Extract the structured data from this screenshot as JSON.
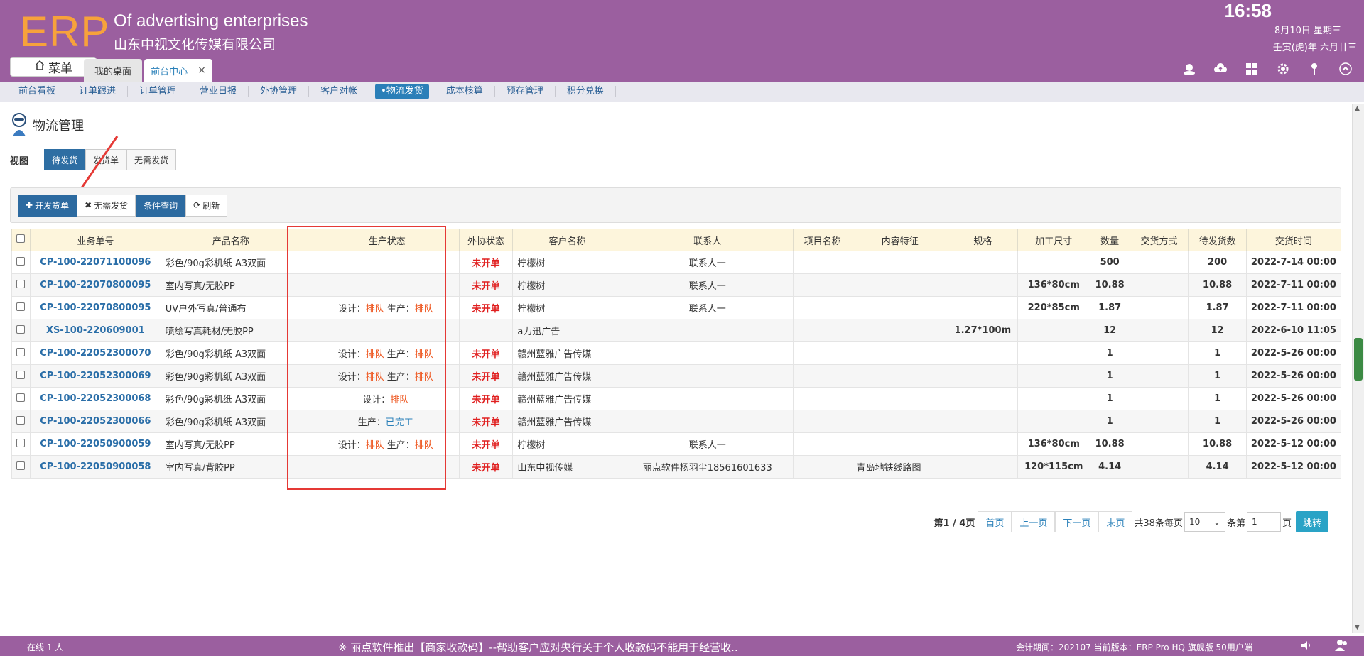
{
  "header": {
    "logo": "ERP",
    "company_en": "Of advertising enterprises",
    "company_cn": "山东中视文化传媒有限公司",
    "time": "16:58",
    "date": "8月10日 星期三",
    "lunar": "壬寅(虎)年 六月廿三",
    "menu_label": "菜单",
    "tabs": [
      {
        "label": "我的桌面"
      },
      {
        "label": "前台中心",
        "close": "×"
      }
    ]
  },
  "nav": {
    "items": [
      "前台看板",
      "订单跟进",
      "订单管理",
      "营业日报",
      "外协管理",
      "客户对帐",
      "•物流发货",
      "成本核算",
      "预存管理",
      "积分兑换"
    ],
    "active_index": 6
  },
  "page": {
    "title": "物流管理",
    "view_label": "视图",
    "views": [
      "待发货",
      "发货单",
      "无需发货"
    ],
    "active_view": 0
  },
  "toolbar": {
    "new_label": "开发货单",
    "no_ship_label": "无需发货",
    "query_label": "条件查询",
    "refresh_label": "刷新"
  },
  "table": {
    "headers": [
      "业务单号",
      "产品名称",
      "",
      "生产状态",
      "外协状态",
      "客户名称",
      "联系人",
      "项目名称",
      "内容特征",
      "规格",
      "加工尺寸",
      "数量",
      "交货方式",
      "待发货数",
      "交货时间"
    ],
    "rows": [
      {
        "order": "CP-100-22071100096",
        "product": "彩色/90g彩机纸 A3双面",
        "prod_status": [],
        "outsource": "未开单",
        "customer": "柠檬树",
        "contact": "联系人一",
        "project": "",
        "content": "",
        "spec": "",
        "size": "",
        "qty": "500",
        "delivery": "",
        "pending": "200",
        "time": "2022-7-14 00:00"
      },
      {
        "order": "CP-100-22070800095",
        "product": "室内写真/无胶PP",
        "prod_status": [],
        "outsource": "未开单",
        "customer": "柠檬树",
        "contact": "联系人一",
        "project": "",
        "content": "",
        "spec": "",
        "size": "136*80cm",
        "qty": "10.88",
        "delivery": "",
        "pending": "10.88",
        "time": "2022-7-11 00:00"
      },
      {
        "order": "CP-100-22070800095",
        "product": "UV户外写真/普通布",
        "prod_status": [
          {
            "label": "设计：",
            "value": "排队",
            "color": "orange"
          },
          {
            "label": "生产：",
            "value": "排队",
            "color": "orange"
          }
        ],
        "outsource": "未开单",
        "customer": "柠檬树",
        "contact": "联系人一",
        "project": "",
        "content": "",
        "spec": "",
        "size": "220*85cm",
        "qty": "1.87",
        "delivery": "",
        "pending": "1.87",
        "time": "2022-7-11 00:00"
      },
      {
        "order": "XS-100-220609001",
        "product": "喷绘写真耗材/无胶PP",
        "prod_status": [],
        "outsource": "",
        "customer": "a力迅广告",
        "contact": "",
        "project": "",
        "content": "",
        "spec": "1.27*100m",
        "size": "",
        "qty": "12",
        "delivery": "",
        "pending": "12",
        "time": "2022-6-10 11:05"
      },
      {
        "order": "CP-100-22052300070",
        "product": "彩色/90g彩机纸 A3双面",
        "prod_status": [
          {
            "label": "设计：",
            "value": "排队",
            "color": "orange"
          },
          {
            "label": "生产：",
            "value": "排队",
            "color": "orange"
          }
        ],
        "outsource": "未开单",
        "customer": "赣州蓝雅广告传媒",
        "contact": "",
        "project": "",
        "content": "",
        "spec": "",
        "size": "",
        "qty": "1",
        "delivery": "",
        "pending": "1",
        "time": "2022-5-26 00:00"
      },
      {
        "order": "CP-100-22052300069",
        "product": "彩色/90g彩机纸 A3双面",
        "prod_status": [
          {
            "label": "设计：",
            "value": "排队",
            "color": "orange"
          },
          {
            "label": "生产：",
            "value": "排队",
            "color": "orange"
          }
        ],
        "outsource": "未开单",
        "customer": "赣州蓝雅广告传媒",
        "contact": "",
        "project": "",
        "content": "",
        "spec": "",
        "size": "",
        "qty": "1",
        "delivery": "",
        "pending": "1",
        "time": "2022-5-26 00:00"
      },
      {
        "order": "CP-100-22052300068",
        "product": "彩色/90g彩机纸 A3双面",
        "prod_status": [
          {
            "label": "设计：",
            "value": "排队",
            "color": "orange"
          }
        ],
        "outsource": "未开单",
        "customer": "赣州蓝雅广告传媒",
        "contact": "",
        "project": "",
        "content": "",
        "spec": "",
        "size": "",
        "qty": "1",
        "delivery": "",
        "pending": "1",
        "time": "2022-5-26 00:00"
      },
      {
        "order": "CP-100-22052300066",
        "product": "彩色/90g彩机纸 A3双面",
        "prod_status": [
          {
            "label": "生产：",
            "value": "已完工",
            "color": "blue"
          }
        ],
        "outsource": "未开单",
        "customer": "赣州蓝雅广告传媒",
        "contact": "",
        "project": "",
        "content": "",
        "spec": "",
        "size": "",
        "qty": "1",
        "delivery": "",
        "pending": "1",
        "time": "2022-5-26 00:00"
      },
      {
        "order": "CP-100-22050900059",
        "product": "室内写真/无胶PP",
        "prod_status": [
          {
            "label": "设计：",
            "value": "排队",
            "color": "orange"
          },
          {
            "label": "生产：",
            "value": "排队",
            "color": "orange"
          }
        ],
        "outsource": "未开单",
        "customer": "柠檬树",
        "contact": "联系人一",
        "project": "",
        "content": "",
        "spec": "",
        "size": "136*80cm",
        "qty": "10.88",
        "delivery": "",
        "pending": "10.88",
        "time": "2022-5-12 00:00"
      },
      {
        "order": "CP-100-22050900058",
        "product": "室内写真/背胶PP",
        "prod_status": [],
        "outsource": "未开单",
        "customer": "山东中视传媒",
        "contact": "丽点软件杨羽尘18561601633",
        "project": "",
        "content": "青岛地铁线路图",
        "spec": "",
        "size": "120*115cm",
        "qty": "4.14",
        "delivery": "",
        "pending": "4.14",
        "time": "2022-5-12 00:00"
      }
    ]
  },
  "pager": {
    "page_info": "第1 / 4页",
    "first": "首页",
    "prev": "上一页",
    "next": "下一页",
    "last": "末页",
    "total": "共38条每页",
    "per_page": "10",
    "per_page_suffix": "条第",
    "goto_value": "1",
    "page_suffix": "页",
    "go": "跳转"
  },
  "footer": {
    "online": "在线  1  人",
    "notice": "※ 丽点软件推出【商家收款码】--帮助客户应对央行关于个人收款码不能用于经营收..",
    "period": "会计期间：202107 当前版本：ERP Pro HQ 旗舰版 50用户端"
  },
  "colors": {
    "header_bg": "#9b5f9f",
    "logo": "#f7a23b",
    "primary": "#2c6aa0",
    "link": "#2a6ea8",
    "alert_red": "#e02020",
    "queue_orange": "#ee5a24",
    "done_blue": "#2a80b9",
    "table_header": "#fdf5dc"
  }
}
